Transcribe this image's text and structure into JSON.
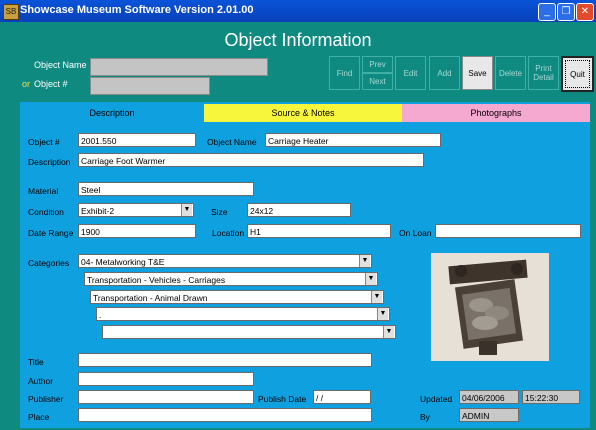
{
  "window": {
    "title": "Showcase Museum Software Version 2.01.00"
  },
  "header": {
    "title": "Object Information",
    "object_name_label": "Object Name",
    "or_label": "or",
    "object_num_label": "Object #"
  },
  "toolbar": {
    "find": "Find",
    "prev": "Prev",
    "next": "Next",
    "edit": "Edit",
    "add": "Add",
    "save": "Save",
    "delete": "Delete",
    "print_detail": "Print Detail",
    "quit": "Quit"
  },
  "tabs": [
    {
      "label": "Description",
      "color": "#0fa0e0"
    },
    {
      "label": "Source & Notes",
      "color": "#f7f53c"
    },
    {
      "label": "Photographs",
      "color": "#f5a8d0"
    }
  ],
  "form": {
    "object_num_label": "Object #",
    "object_num": "2001.550",
    "object_name_label": "Object Name",
    "object_name": "Carriage Heater",
    "description_label": "Description",
    "description": "Carriage Foot Warmer",
    "material_label": "Material",
    "material": "Steel",
    "condition_label": "Condition",
    "condition": "Exhibit-2",
    "size_label": "Size",
    "size": "24x12",
    "date_range_label": "Date Range",
    "date_range": "1900",
    "location_label": "Location",
    "location": "H1",
    "on_loan_label": "On Loan",
    "on_loan": "",
    "categories_label": "Categories",
    "categories": [
      "04- Metalworking T&E",
      "Transportation - Vehicles - Carriages",
      "Transportation - Animal Drawn",
      ".",
      ""
    ],
    "title_label": "Title",
    "title": "",
    "author_label": "Author",
    "author": "",
    "publisher_label": "Publisher",
    "publisher": "",
    "publish_date_label": "Publish Date",
    "publish_date": " / /",
    "place_label": "Place",
    "place": "",
    "updated_label": "Updated",
    "updated_date": "04/06/2006",
    "updated_time": "15:22:30",
    "by_label": "By",
    "by": "ADMIN"
  },
  "icons": {
    "app": "museum-app-icon",
    "photo": "object-photo"
  }
}
